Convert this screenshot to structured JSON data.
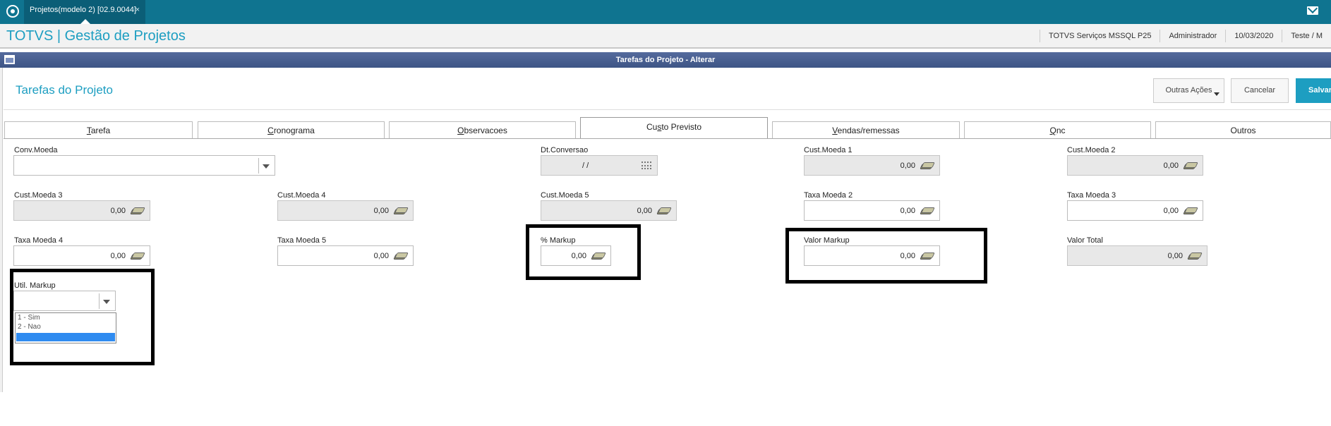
{
  "topbar": {
    "tab_label": "Projetos(modelo 2) [02.9.0044]",
    "tab_close": "×"
  },
  "header": {
    "app_title": "TOTVS | Gestão de Projetos",
    "env": "TOTVS Serviços MSSQL P25",
    "user": "Administrador",
    "date": "10/03/2020",
    "extra": "Teste / M"
  },
  "window": {
    "title": "Tarefas do Projeto - Alterar"
  },
  "page": {
    "title": "Tarefas do Projeto"
  },
  "buttons": {
    "outras": "Outras Ações",
    "cancelar": "Cancelar",
    "salvar": "Salvar"
  },
  "tabs": [
    {
      "pre": "",
      "u": "T",
      "post": "arefa"
    },
    {
      "pre": "",
      "u": "C",
      "post": "ronograma"
    },
    {
      "pre": "",
      "u": "O",
      "post": "bservacoes"
    },
    {
      "pre": "Cu",
      "u": "s",
      "post": "to Previsto"
    },
    {
      "pre": "",
      "u": "V",
      "post": "endas/remessas"
    },
    {
      "pre": "",
      "u": "Q",
      "post": "nc"
    },
    {
      "pre": "",
      "u": "",
      "post": "Outros"
    }
  ],
  "fields": {
    "conv_moeda": {
      "label": "Conv.Moeda",
      "value": ""
    },
    "dt_conversao": {
      "label": "Dt.Conversao",
      "value": "/  /"
    },
    "cust_moeda1": {
      "label": "Cust.Moeda 1",
      "value": "0,00"
    },
    "cust_moeda2": {
      "label": "Cust.Moeda 2",
      "value": "0,00"
    },
    "cust_moeda3": {
      "label": "Cust.Moeda 3",
      "value": "0,00"
    },
    "cust_moeda4": {
      "label": "Cust.Moeda 4",
      "value": "0,00"
    },
    "cust_moeda5": {
      "label": "Cust.Moeda 5",
      "value": "0,00"
    },
    "taxa_moeda2": {
      "label": "Taxa Moeda 2",
      "value": "0,00"
    },
    "taxa_moeda3": {
      "label": "Taxa Moeda 3",
      "value": "0,00"
    },
    "taxa_moeda4": {
      "label": "Taxa Moeda 4",
      "value": "0,00"
    },
    "taxa_moeda5": {
      "label": "Taxa Moeda 5",
      "value": "0,00"
    },
    "markup_pct": {
      "label": "% Markup",
      "value": "0,00"
    },
    "valor_markup": {
      "label": "Valor Markup",
      "value": "0,00"
    },
    "valor_total": {
      "label": "Valor Total",
      "value": "0,00"
    },
    "util_markup": {
      "label": "Util. Markup",
      "value": "",
      "options": [
        "1 - Sim",
        "2 - Nao",
        ""
      ]
    }
  }
}
